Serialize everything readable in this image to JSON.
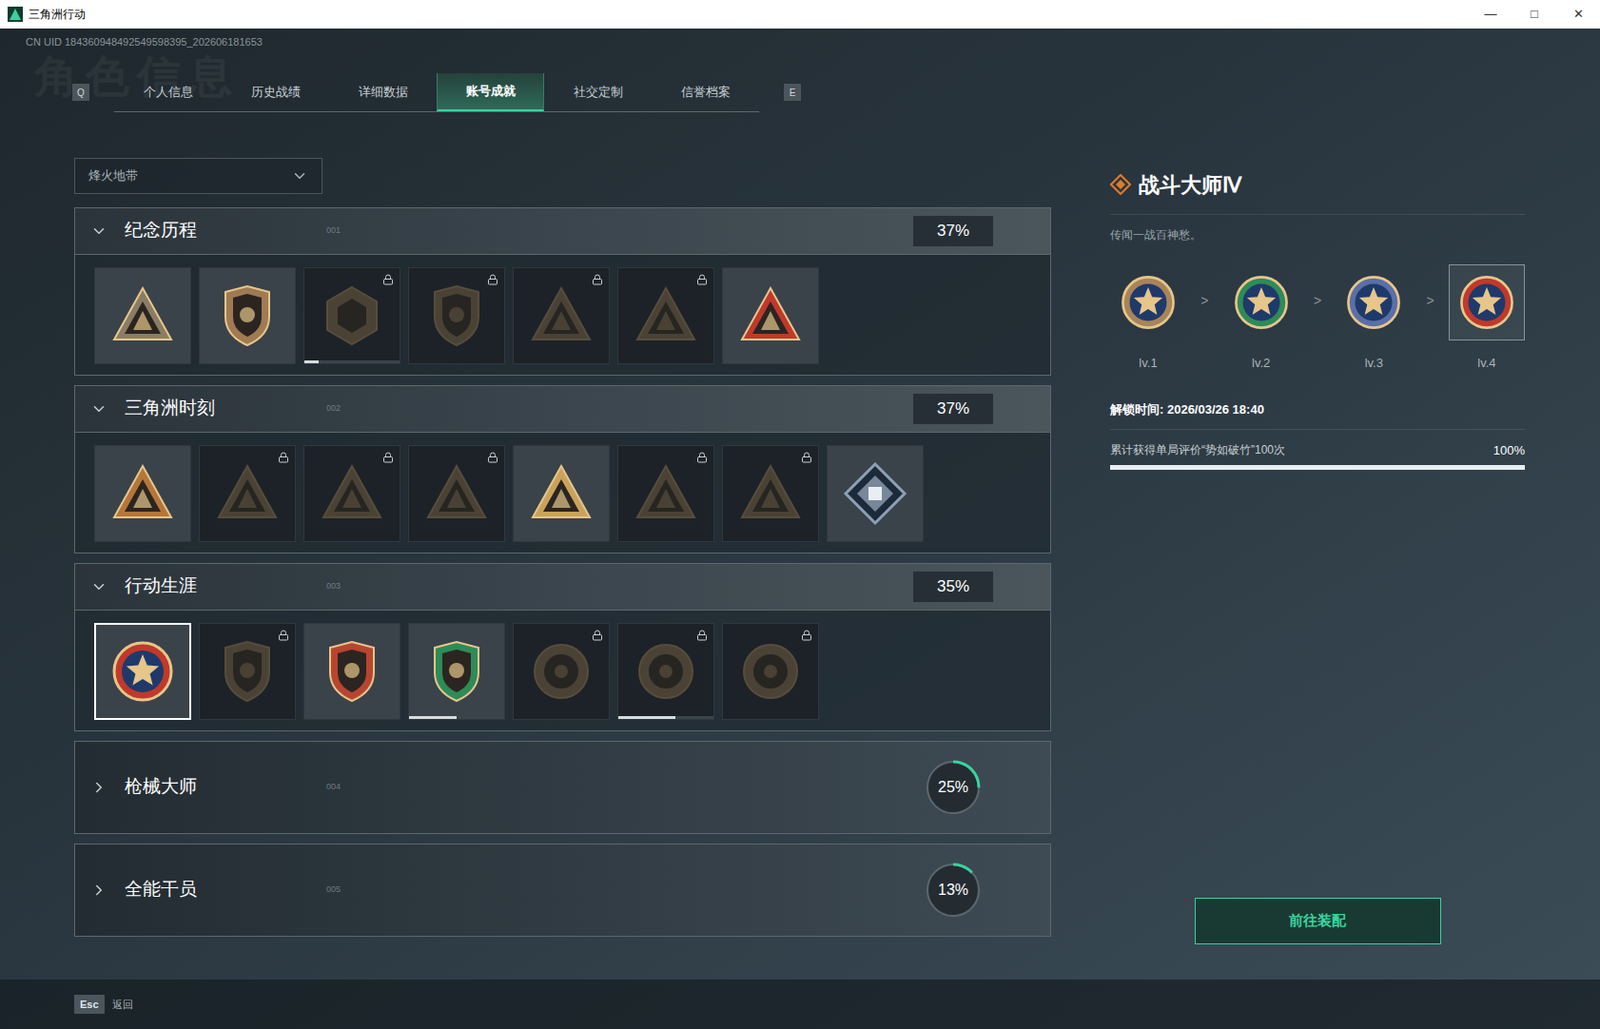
{
  "window": {
    "title": "三角洲行动",
    "controls": [
      "—",
      "□",
      "✕"
    ]
  },
  "uid": "CN UID 184360948492549598395_202606181653",
  "watermark": "角色信息",
  "tabs": {
    "prev_key": "Q",
    "next_key": "E",
    "items": [
      {
        "label": "个人信息",
        "selected": false
      },
      {
        "label": "历史战绩",
        "selected": false
      },
      {
        "label": "详细数据",
        "selected": false
      },
      {
        "label": "账号成就",
        "selected": true
      },
      {
        "label": "社交定制",
        "selected": false
      },
      {
        "label": "信誉档案",
        "selected": false
      }
    ]
  },
  "mode_select": {
    "value": "烽火地带"
  },
  "sections": [
    {
      "title": "纪念历程",
      "code": "001",
      "percent": "37%",
      "level": 0.37,
      "expanded": true,
      "items": [
        {
          "kind": "triangle",
          "locked": false,
          "selected": false,
          "color": "#8a7d66"
        },
        {
          "kind": "shield",
          "locked": false,
          "selected": false,
          "color": "#a07a52"
        },
        {
          "kind": "hex",
          "locked": true,
          "selected": false,
          "color": "#5a4d3a",
          "level": 0.15
        },
        {
          "kind": "shield",
          "locked": true,
          "selected": false,
          "color": "#5a4d3a"
        },
        {
          "kind": "triangle",
          "locked": true,
          "selected": false,
          "color": "#5a4d3a"
        },
        {
          "kind": "triangle",
          "locked": true,
          "selected": false,
          "color": "#5a4d3a"
        },
        {
          "kind": "triangle",
          "locked": false,
          "selected": false,
          "color": "#c0392b"
        }
      ]
    },
    {
      "title": "三角洲时刻",
      "code": "002",
      "percent": "37%",
      "level": 0.37,
      "expanded": true,
      "items": [
        {
          "kind": "triangle",
          "locked": false,
          "selected": false,
          "color": "#b5763a"
        },
        {
          "kind": "triangle",
          "locked": true,
          "selected": false,
          "color": "#5a4d3a"
        },
        {
          "kind": "triangle",
          "locked": true,
          "selected": false,
          "color": "#5a4d3a"
        },
        {
          "kind": "triangle",
          "locked": true,
          "selected": false,
          "color": "#5a4d3a"
        },
        {
          "kind": "triangle",
          "locked": false,
          "selected": false,
          "color": "#c9a25c"
        },
        {
          "kind": "triangle",
          "locked": true,
          "selected": false,
          "color": "#5a4d3a"
        },
        {
          "kind": "triangle",
          "locked": true,
          "selected": false,
          "color": "#5a4d3a"
        },
        {
          "kind": "diamond",
          "locked": false,
          "selected": false,
          "color": "#8ea0b4"
        }
      ]
    },
    {
      "title": "行动生涯",
      "code": "003",
      "percent": "35%",
      "level": 0.35,
      "expanded": true,
      "items": [
        {
          "kind": "star",
          "locked": false,
          "selected": true,
          "color": "#c0392b"
        },
        {
          "kind": "shield",
          "locked": true,
          "selected": false,
          "color": "#5a4d3a"
        },
        {
          "kind": "shield",
          "locked": false,
          "selected": false,
          "color": "#b8452f"
        },
        {
          "kind": "shield",
          "locked": false,
          "selected": false,
          "color": "#2e8b57",
          "level": 0.5
        },
        {
          "kind": "round",
          "locked": true,
          "selected": false,
          "color": "#5a4d3a"
        },
        {
          "kind": "round",
          "locked": true,
          "selected": false,
          "color": "#5a4d3a",
          "level": 0.6
        },
        {
          "kind": "round",
          "locked": true,
          "selected": false,
          "color": "#5a4d3a"
        }
      ]
    },
    {
      "title": "枪械大师",
      "code": "004",
      "percent": "25%",
      "level": 0.25,
      "expanded": false,
      "items": []
    },
    {
      "title": "全能干员",
      "code": "005",
      "percent": "13%",
      "level": 0.13,
      "expanded": false,
      "items": []
    }
  ],
  "detail": {
    "title": "战斗大师Ⅳ",
    "description": "传闻一战百神愁。",
    "separator": ">",
    "levels": [
      {
        "label": "lv.1",
        "selected": false,
        "color": "#a8845a"
      },
      {
        "label": "lv.2",
        "selected": false,
        "color": "#2e8b57"
      },
      {
        "label": "lv.3",
        "selected": false,
        "color": "#5a6fa8"
      },
      {
        "label": "lv.4",
        "selected": true,
        "color": "#c0392b"
      }
    ],
    "unlock_time": "解锁时间: 2026/03/26 18:40",
    "requirement": "累计获得单局评价“势如破竹”100次",
    "progress_text": "100%",
    "progress": 1.0,
    "button": "前往装配"
  },
  "footer": {
    "key": "Esc",
    "label": "返回"
  }
}
